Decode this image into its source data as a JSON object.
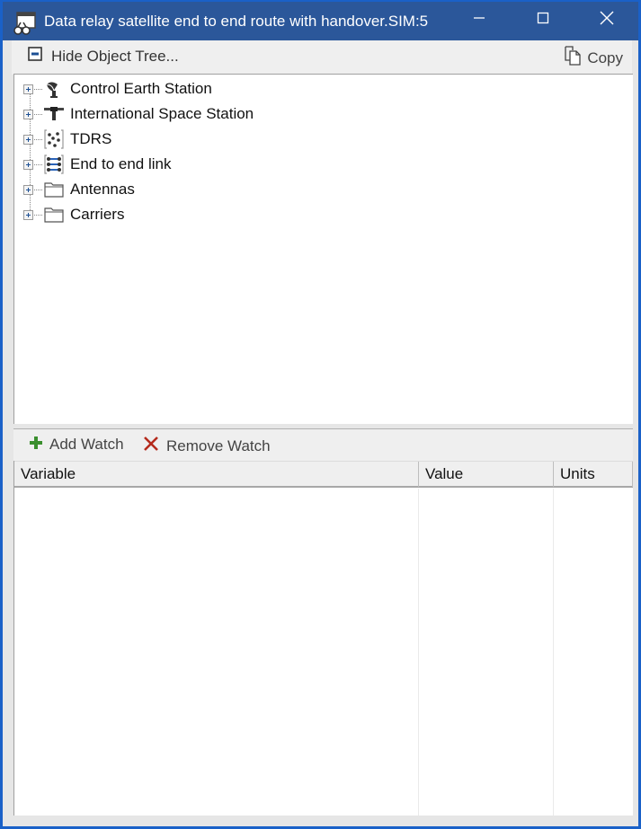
{
  "window": {
    "title": "Data relay satellite end to end route with handover.SIM:5",
    "app_icon": "watch-window-icon",
    "controls": {
      "minimize": "minimize-icon",
      "maximize": "maximize-icon",
      "close": "close-icon"
    }
  },
  "toolbar": {
    "hide_tree_label": "Hide Object Tree...",
    "hide_tree_icon": "collapse-minus-icon",
    "copy_label": "Copy",
    "copy_icon": "copy-icon"
  },
  "tree": {
    "items": [
      {
        "label": "Control Earth Station",
        "icon": "satellite-dish-icon",
        "expanded": false
      },
      {
        "label": "International Space Station",
        "icon": "space-station-icon",
        "expanded": false
      },
      {
        "label": "TDRS",
        "icon": "constellation-icon",
        "expanded": false
      },
      {
        "label": "End to end link",
        "icon": "link-chain-icon",
        "expanded": false
      },
      {
        "label": "Antennas",
        "icon": "folder-icon",
        "expanded": false
      },
      {
        "label": "Carriers",
        "icon": "folder-icon",
        "expanded": false
      }
    ]
  },
  "watch_toolbar": {
    "add_label": "Add Watch",
    "add_icon": "plus-icon",
    "remove_label": "Remove Watch",
    "remove_icon": "x-icon"
  },
  "grid": {
    "columns": [
      "Variable",
      "Value",
      "Units"
    ],
    "rows": []
  },
  "colors": {
    "titlebar": "#2b579a",
    "window_border": "#1a61c8",
    "add_green": "#3a8f2e",
    "remove_red": "#b52a1c"
  }
}
